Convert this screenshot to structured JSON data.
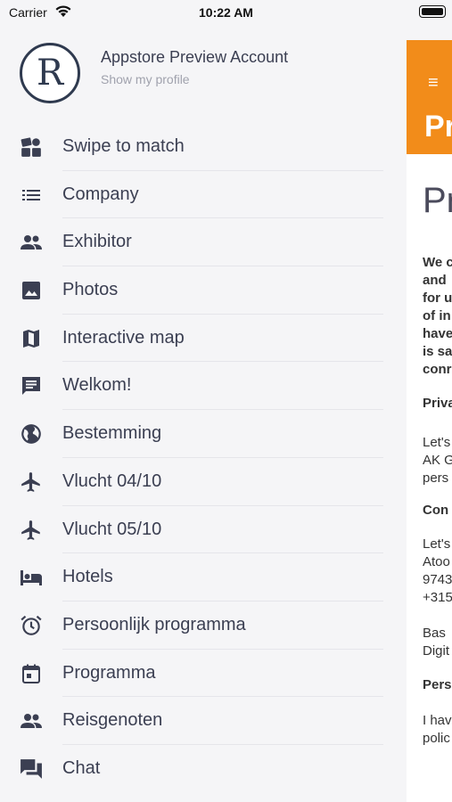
{
  "status_bar": {
    "carrier": "Carrier",
    "time": "10:22 AM"
  },
  "profile": {
    "avatar_letter": "R",
    "name": "Appstore Preview Account",
    "link": "Show my profile"
  },
  "menu": [
    {
      "label": "Swipe to match",
      "icon": "swipe-match-icon"
    },
    {
      "label": "Company",
      "icon": "list-icon"
    },
    {
      "label": "Exhibitor",
      "icon": "people-icon"
    },
    {
      "label": "Photos",
      "icon": "photo-icon"
    },
    {
      "label": "Interactive map",
      "icon": "map-icon"
    },
    {
      "label": "Welkom!",
      "icon": "message-icon"
    },
    {
      "label": "Bestemming",
      "icon": "globe-icon"
    },
    {
      "label": "Vlucht 04/10",
      "icon": "airplane-icon"
    },
    {
      "label": "Vlucht 05/10",
      "icon": "airplane-icon"
    },
    {
      "label": "Hotels",
      "icon": "hotel-bed-icon"
    },
    {
      "label": "Persoonlijk programma",
      "icon": "alarm-icon"
    },
    {
      "label": "Programma",
      "icon": "calendar-icon"
    },
    {
      "label": "Reisgenoten",
      "icon": "people-icon"
    },
    {
      "label": "Chat",
      "icon": "chat-icon"
    }
  ],
  "background_page": {
    "header_color": "#f28c1a",
    "header_title": "Pr",
    "page_heading": "Pr",
    "text_lines": [
      {
        "text": "We c",
        "bold": true
      },
      {
        "text": "and",
        "bold": true
      },
      {
        "text": "for u",
        "bold": true
      },
      {
        "text": "of in",
        "bold": true
      },
      {
        "text": "have",
        "bold": true
      },
      {
        "text": "is sa",
        "bold": true
      },
      {
        "text": "conr",
        "bold": true
      },
      {
        "text": "Priva",
        "bold": true
      },
      {
        "text": "Let's",
        "bold": false
      },
      {
        "text": "AK G",
        "bold": false
      },
      {
        "text": "pers",
        "bold": false
      },
      {
        "text": "Con",
        "bold": true
      },
      {
        "text": "Let's",
        "bold": false
      },
      {
        "text": "Atoo",
        "bold": false
      },
      {
        "text": "9743",
        "bold": false
      },
      {
        "text": "+315",
        "bold": false
      },
      {
        "text": "Bas",
        "bold": false
      },
      {
        "text": "Digit",
        "bold": false
      },
      {
        "text": "Pers",
        "bold": true
      },
      {
        "text": "I hav",
        "bold": false
      },
      {
        "text": "polic",
        "bold": false
      }
    ]
  }
}
